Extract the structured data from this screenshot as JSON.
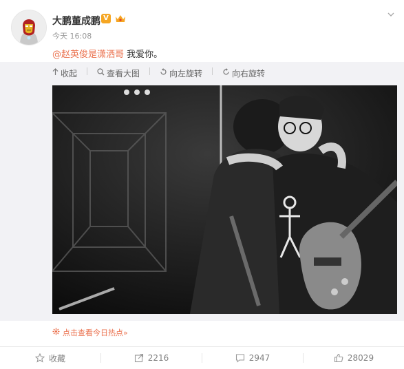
{
  "post": {
    "author": "大鹏董成鹏",
    "verified_badge": "V",
    "time": "今天 16:08",
    "content": {
      "mention": "@赵英俊是潇洒哥",
      "text": " 我爱你。"
    }
  },
  "media_toolbar": {
    "collapse": "收起",
    "view_large": "查看大图",
    "rotate_left": "向左旋转",
    "rotate_right": "向右旋转"
  },
  "hot_link": "点击查看今日热点»",
  "actions": {
    "favorite": "收藏",
    "repost": "2216",
    "comment": "2947",
    "like": "28029"
  },
  "colors": {
    "accent": "#eb7350",
    "verified": "#f5a623",
    "muted": "#808080"
  },
  "icons": [
    "iron-man-avatar",
    "chevron-down-icon",
    "verified-icon",
    "crown-icon",
    "collapse-icon",
    "magnify-icon",
    "rotate-left-icon",
    "rotate-right-icon",
    "hot-icon",
    "star-icon",
    "repost-icon",
    "comment-icon",
    "like-icon"
  ]
}
